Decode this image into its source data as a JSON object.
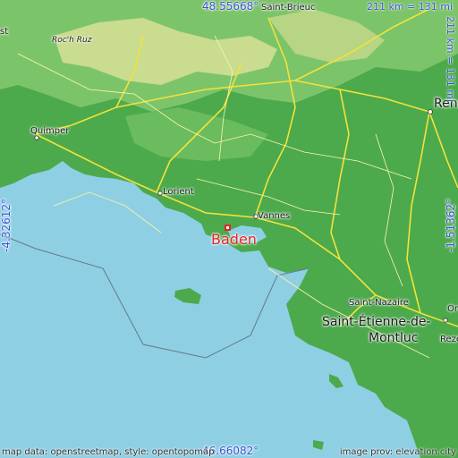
{
  "coordinates": {
    "north": "48.55668°",
    "south": "46.66082°",
    "west": "-4.32612°",
    "east": "-1.51362°"
  },
  "scale": {
    "top": "211 km = 131 mi",
    "right": "211 km = 131 mi"
  },
  "city": {
    "name": "Baden",
    "color": "#e0262b"
  },
  "places": {
    "saint_brieuc": "Saint-Brieuc",
    "roc_h_ruz": "Roc'h Ruz",
    "quimper": "Quimper",
    "lorient": "Lorient",
    "vannes": "Vannes",
    "rennes": "Renn",
    "saint_nazaire": "Saint-Nazaire",
    "saint_etienne_1": "Saint-Étienne-de-",
    "saint_etienne_2": "Montluc",
    "orv": "Orv",
    "reze": "Rezé",
    "west_cut": "st"
  },
  "credits": {
    "left": "map data: openstreetmap, style: opentopomap",
    "right": "image prov: elevation.city"
  },
  "colors": {
    "sea": "#8fcfe3",
    "lowland": "#4caa4c",
    "upland": "#7cc46a",
    "highland": "#c9dc90",
    "roads": "#f3e23a",
    "accent": "#3a55d6"
  }
}
